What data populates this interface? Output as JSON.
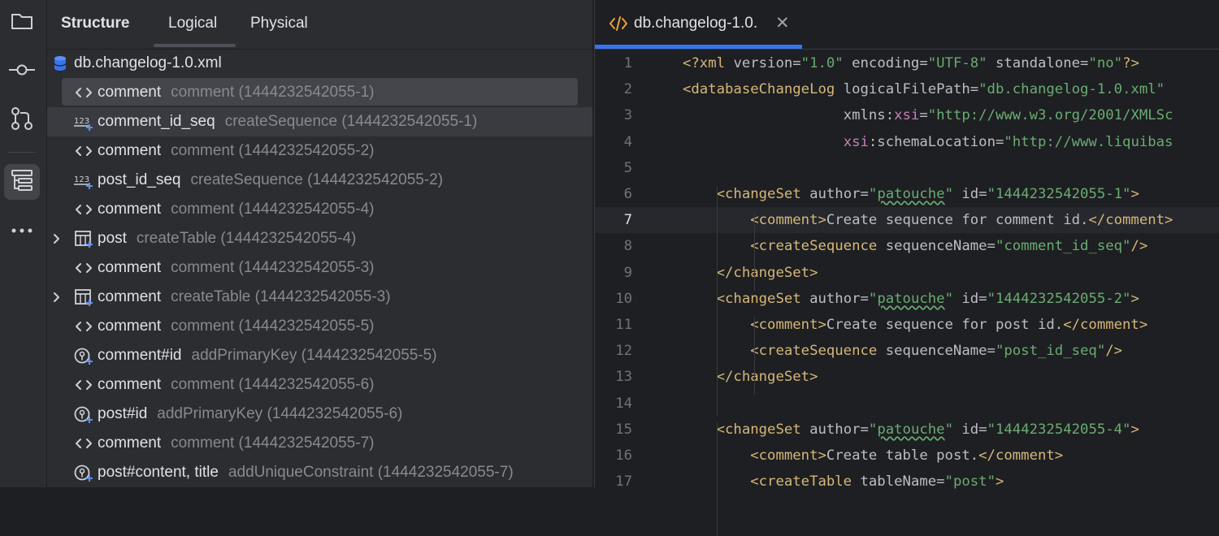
{
  "colors": {
    "background": "#1e1f22",
    "panel": "#2b2d30",
    "accent": "#3574f0",
    "selection": "#43454a",
    "tag": "#d5b778",
    "attr_value": "#6aab73",
    "namespace": "#c77dbb",
    "secondary_text": "#868a91"
  },
  "toolstrip": {
    "items": [
      {
        "icon": "folder-icon"
      },
      {
        "icon": "commit-icon"
      },
      {
        "icon": "pull-request-icon"
      },
      {
        "icon": "structure-icon",
        "active": true
      },
      {
        "icon": "more-icon"
      }
    ]
  },
  "structure": {
    "title": "Structure",
    "tabs": [
      "Logical",
      "Physical"
    ],
    "root": "db.changelog-1.0.xml",
    "items": [
      {
        "icon": "xml-tag-icon",
        "name": "comment",
        "desc": "comment (1444232542055-1)",
        "selected": true
      },
      {
        "icon": "sequence-icon",
        "name": "comment_id_seq",
        "desc": "createSequence (1444232542055-1)"
      },
      {
        "icon": "xml-tag-icon",
        "name": "comment",
        "desc": "comment (1444232542055-2)"
      },
      {
        "icon": "sequence-icon",
        "name": "post_id_seq",
        "desc": "createSequence (1444232542055-2)"
      },
      {
        "icon": "xml-tag-icon",
        "name": "comment",
        "desc": "comment (1444232542055-4)"
      },
      {
        "icon": "table-icon",
        "name": "post",
        "desc": "createTable (1444232542055-4)",
        "expandable": true
      },
      {
        "icon": "xml-tag-icon",
        "name": "comment",
        "desc": "comment (1444232542055-3)"
      },
      {
        "icon": "table-icon",
        "name": "comment",
        "desc": "createTable (1444232542055-3)",
        "expandable": true
      },
      {
        "icon": "xml-tag-icon",
        "name": "comment",
        "desc": "comment (1444232542055-5)"
      },
      {
        "icon": "primary-key-icon",
        "name": "comment#id",
        "desc": "addPrimaryKey (1444232542055-5)"
      },
      {
        "icon": "xml-tag-icon",
        "name": "comment",
        "desc": "comment (1444232542055-6)"
      },
      {
        "icon": "primary-key-icon",
        "name": "post#id",
        "desc": "addPrimaryKey (1444232542055-6)"
      },
      {
        "icon": "xml-tag-icon",
        "name": "comment",
        "desc": "comment (1444232542055-7)"
      },
      {
        "icon": "unique-constraint-icon",
        "name": "post#content, title",
        "desc": "addUniqueConstraint (1444232542055-7)"
      }
    ]
  },
  "editor": {
    "tab_title": "db.changelog-1.0.",
    "current_line": 7,
    "lines": [
      {
        "n": 1,
        "tokens": [
          [
            "tag",
            "<?xml "
          ],
          [
            "attr",
            "version="
          ],
          [
            "val",
            "\"1.0\""
          ],
          [
            "attr",
            " encoding="
          ],
          [
            "val",
            "\"UTF-8\""
          ],
          [
            "attr",
            " standalone="
          ],
          [
            "val",
            "\"no\""
          ],
          [
            "tag",
            "?>"
          ]
        ]
      },
      {
        "n": 2,
        "tokens": [
          [
            "tag",
            "<databaseChangeLog "
          ],
          [
            "attr",
            "logicalFilePath="
          ],
          [
            "val",
            "\"db.changelog-1.0.xml\""
          ]
        ]
      },
      {
        "n": 3,
        "tokens": [
          [
            "txt",
            "                   "
          ],
          [
            "attr",
            "xmlns:"
          ],
          [
            "ns",
            "xsi"
          ],
          [
            "attr",
            "="
          ],
          [
            "val",
            "\"http://www.w3.org/2001/XMLSc"
          ]
        ]
      },
      {
        "n": 4,
        "tokens": [
          [
            "txt",
            "                   "
          ],
          [
            "ns",
            "xsi"
          ],
          [
            "attr",
            ":schemaLocation="
          ],
          [
            "val",
            "\"http://www.liquibas"
          ]
        ]
      },
      {
        "n": 5,
        "tokens": []
      },
      {
        "n": 6,
        "tokens": [
          [
            "txt",
            "    "
          ],
          [
            "tag",
            "<changeSet "
          ],
          [
            "attr",
            "author="
          ],
          [
            "val",
            "\""
          ],
          [
            "typo",
            "patouche"
          ],
          [
            "val",
            "\""
          ],
          [
            "attr",
            " id="
          ],
          [
            "val",
            "\"1444232542055-1\""
          ],
          [
            "tag",
            ">"
          ]
        ]
      },
      {
        "n": 7,
        "tokens": [
          [
            "txt",
            "        "
          ],
          [
            "tag",
            "<comment>"
          ],
          [
            "txt",
            "Create sequence for comment id."
          ],
          [
            "tag",
            "</comment>"
          ]
        ]
      },
      {
        "n": 8,
        "tokens": [
          [
            "txt",
            "        "
          ],
          [
            "tag",
            "<createSequence "
          ],
          [
            "attr",
            "sequenceName="
          ],
          [
            "val",
            "\"comment_id_seq\""
          ],
          [
            "tag",
            "/>"
          ]
        ]
      },
      {
        "n": 9,
        "tokens": [
          [
            "txt",
            "    "
          ],
          [
            "tag",
            "</changeSet>"
          ]
        ]
      },
      {
        "n": 10,
        "tokens": [
          [
            "txt",
            "    "
          ],
          [
            "tag",
            "<changeSet "
          ],
          [
            "attr",
            "author="
          ],
          [
            "val",
            "\""
          ],
          [
            "typo",
            "patouche"
          ],
          [
            "val",
            "\""
          ],
          [
            "attr",
            " id="
          ],
          [
            "val",
            "\"1444232542055-2\""
          ],
          [
            "tag",
            ">"
          ]
        ]
      },
      {
        "n": 11,
        "tokens": [
          [
            "txt",
            "        "
          ],
          [
            "tag",
            "<comment>"
          ],
          [
            "txt",
            "Create sequence for post id."
          ],
          [
            "tag",
            "</comment>"
          ]
        ]
      },
      {
        "n": 12,
        "tokens": [
          [
            "txt",
            "        "
          ],
          [
            "tag",
            "<createSequence "
          ],
          [
            "attr",
            "sequenceName="
          ],
          [
            "val",
            "\"post_id_seq\""
          ],
          [
            "tag",
            "/>"
          ]
        ]
      },
      {
        "n": 13,
        "tokens": [
          [
            "txt",
            "    "
          ],
          [
            "tag",
            "</changeSet>"
          ]
        ]
      },
      {
        "n": 14,
        "tokens": []
      },
      {
        "n": 15,
        "tokens": [
          [
            "txt",
            "    "
          ],
          [
            "tag",
            "<changeSet "
          ],
          [
            "attr",
            "author="
          ],
          [
            "val",
            "\""
          ],
          [
            "typo",
            "patouche"
          ],
          [
            "val",
            "\""
          ],
          [
            "attr",
            " id="
          ],
          [
            "val",
            "\"1444232542055-4\""
          ],
          [
            "tag",
            ">"
          ]
        ]
      },
      {
        "n": 16,
        "tokens": [
          [
            "txt",
            "        "
          ],
          [
            "tag",
            "<comment>"
          ],
          [
            "txt",
            "Create table post."
          ],
          [
            "tag",
            "</comment>"
          ]
        ]
      },
      {
        "n": 17,
        "tokens": [
          [
            "txt",
            "        "
          ],
          [
            "tag",
            "<createTable "
          ],
          [
            "attr",
            "tableName="
          ],
          [
            "val",
            "\"post\""
          ],
          [
            "tag",
            ">"
          ]
        ]
      }
    ]
  }
}
